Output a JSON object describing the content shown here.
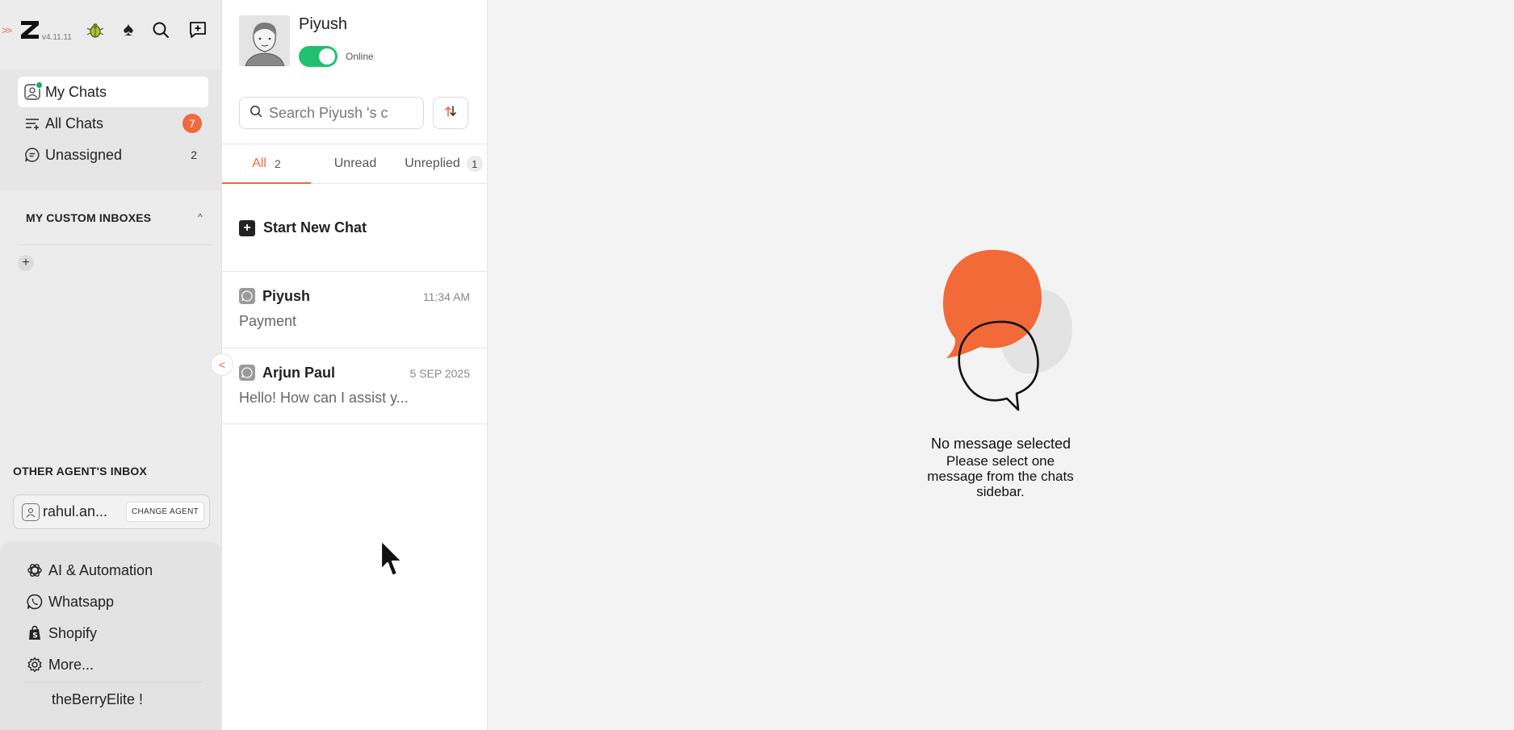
{
  "app": {
    "version": "v4.11.11",
    "brand_letter": "Z"
  },
  "sidebar": {
    "nav": [
      {
        "label": "My Chats",
        "icon": "agent-avatar-icon",
        "active": true
      },
      {
        "label": "All Chats",
        "icon": "filter-list-icon",
        "count": "7"
      },
      {
        "label": "Unassigned",
        "icon": "chat-bubble-icon",
        "count": "2"
      }
    ],
    "custom_inboxes_title": "MY CUSTOM INBOXES",
    "other_agents_title": "OTHER AGENT'S INBOX",
    "agent": {
      "name": "rahul.an...",
      "change_label": "CHANGE AGENT"
    },
    "bottom": [
      {
        "label": "AI & Automation",
        "icon": "openai-icon"
      },
      {
        "label": "Whatsapp",
        "icon": "whatsapp-icon"
      },
      {
        "label": "Shopify",
        "icon": "shopify-icon"
      },
      {
        "label": "More...",
        "icon": "gear-icon"
      }
    ],
    "store_name": "theBerryElite !"
  },
  "chatlist": {
    "agent_name": "Piyush",
    "status": "Online",
    "search_placeholder": "Search Piyush 's c",
    "tabs": [
      {
        "label": "All",
        "count": "2",
        "active": true
      },
      {
        "label": "Unread",
        "count": ""
      },
      {
        "label": "Unreplied",
        "count": "1"
      }
    ],
    "new_chat_label": "Start New Chat",
    "chats": [
      {
        "name": "Piyush",
        "time": "11:34 AM",
        "preview": "Payment"
      },
      {
        "name": "Arjun Paul",
        "time": "5 SEP 2025",
        "preview": "Hello! How can I assist y..."
      }
    ]
  },
  "main": {
    "empty_title": "No message selected",
    "empty_subtitle": "Please select one message from the chats sidebar."
  },
  "colors": {
    "accent": "#ef6a3d",
    "online": "#22c06e",
    "sidebar_bg": "#ececec"
  }
}
